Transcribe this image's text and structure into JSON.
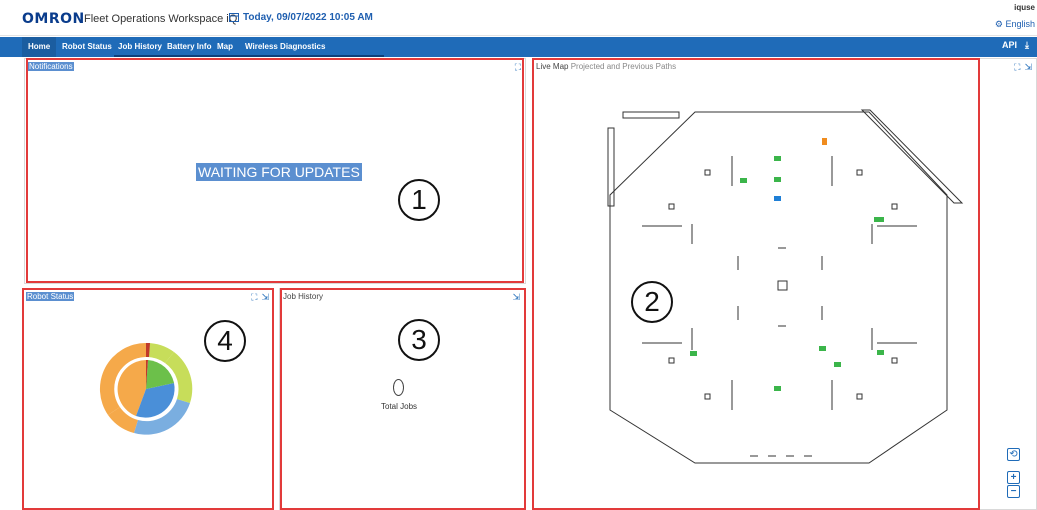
{
  "header": {
    "logo": "OMRON",
    "app_title": "Fleet Operations Workspace iQ",
    "date": "Today, 09/07/2022 10:05 AM",
    "user": "iquse",
    "language": "English"
  },
  "nav": {
    "tabs": [
      {
        "label": "Home",
        "active": true
      },
      {
        "label": "Robot Status"
      },
      {
        "label": "Job History"
      },
      {
        "label": "Battery Info"
      },
      {
        "label": "Map"
      },
      {
        "label": "Wireless Diagnostics"
      }
    ],
    "api_label": "API"
  },
  "notifications": {
    "title": "Notifications",
    "message": "WAITING FOR UPDATES"
  },
  "live_map": {
    "title": "Live Map",
    "subtitle": "Projected and Previous Paths"
  },
  "robot_status": {
    "title": "Robot Status"
  },
  "job_history": {
    "title": "Job History",
    "total_label": "Total Jobs"
  },
  "callouts": [
    "1",
    "2",
    "3",
    "4"
  ],
  "colors": {
    "nav": "#1f6bb8",
    "highlight": "#5b8fd0",
    "callout_border": "#e23a3a",
    "pie_orange": "#f5a94a",
    "pie_blue": "#7aaee0",
    "pie_green": "#6cc04a",
    "pie_yellow_green": "#c7dd5a",
    "pie_red": "#c0392b"
  }
}
